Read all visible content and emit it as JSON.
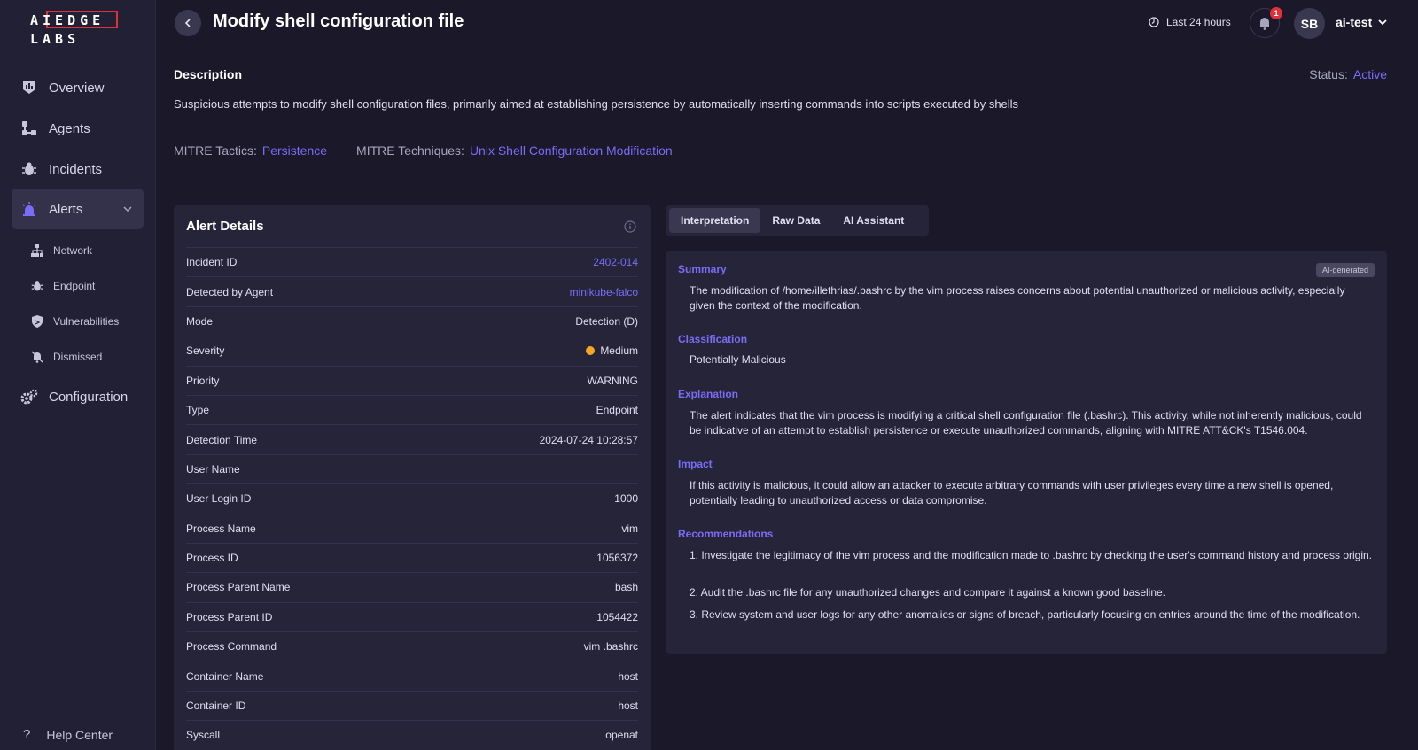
{
  "logo": {
    "line1": "AIEDGE",
    "line2": "LABS"
  },
  "sidebar": {
    "items": [
      {
        "label": "Overview"
      },
      {
        "label": "Agents"
      },
      {
        "label": "Incidents"
      },
      {
        "label": "Alerts"
      },
      {
        "label": "Configuration"
      }
    ],
    "sub_items": [
      {
        "label": "Network"
      },
      {
        "label": "Endpoint"
      },
      {
        "label": "Vulnerabilities"
      },
      {
        "label": "Dismissed"
      }
    ],
    "help": {
      "icon": "?",
      "label": "Help Center"
    }
  },
  "header": {
    "title": "Modify shell configuration file",
    "time_range": "Last 24 hours",
    "notification_count": "1",
    "avatar_initials": "SB",
    "username": "ai-test"
  },
  "description": {
    "heading": "Description",
    "status_label": "Status:",
    "status_value": "Active",
    "text": "Suspicious attempts to modify shell configuration files, primarily aimed at establishing persistence by automatically inserting commands into scripts executed by shells",
    "tactics_label": "MITRE Tactics:",
    "tactics_value": "Persistence",
    "techniques_label": "MITRE Techniques:",
    "techniques_value": "Unix Shell Configuration Modification"
  },
  "alert_details": {
    "title": "Alert Details",
    "rows": [
      {
        "key": "Incident ID",
        "value": "2402-014"
      },
      {
        "key": "Detected by Agent",
        "value": "minikube-falco"
      },
      {
        "key": "Mode",
        "value": "Detection (D)"
      },
      {
        "key": "Severity",
        "value": "Medium"
      },
      {
        "key": "Priority",
        "value": "WARNING"
      },
      {
        "key": "Type",
        "value": "Endpoint"
      },
      {
        "key": "Detection Time",
        "value": "2024-07-24 10:28:57"
      },
      {
        "key": "User Name",
        "value": ""
      },
      {
        "key": "User Login ID",
        "value": "1000"
      },
      {
        "key": "Process Name",
        "value": "vim"
      },
      {
        "key": "Process ID",
        "value": "1056372"
      },
      {
        "key": "Process Parent Name",
        "value": "bash"
      },
      {
        "key": "Process Parent ID",
        "value": "1054422"
      },
      {
        "key": "Process Command",
        "value": "vim .bashrc"
      },
      {
        "key": "Container Name",
        "value": "host"
      },
      {
        "key": "Container ID",
        "value": "host"
      },
      {
        "key": "Syscall",
        "value": "openat"
      }
    ]
  },
  "tabs": [
    {
      "label": "Interpretation"
    },
    {
      "label": "Raw Data"
    },
    {
      "label": "AI Assistant"
    }
  ],
  "interpretation": {
    "badge": "AI-generated",
    "summary_h": "Summary",
    "summary_t": "The modification of /home/illethrias/.bashrc by the vim process raises concerns about potential unauthorized or malicious activity, especially given the context of the modification.",
    "classification_h": "Classification",
    "classification_t": "Potentially Malicious",
    "explanation_h": "Explanation",
    "explanation_t": "The alert indicates that the vim process is modifying a critical shell configuration file (.bashrc). This activity, while not inherently malicious, could be indicative of an attempt to establish persistence or execute unauthorized commands, aligning with MITRE ATT&CK's T1546.004.",
    "impact_h": "Impact",
    "impact_t": "If this activity is malicious, it could allow an attacker to execute arbitrary commands with user privileges every time a new shell is opened, potentially leading to unauthorized access or data compromise.",
    "recommendations_h": "Recommendations",
    "rec1": "1. Investigate the legitimacy of the vim process and the modification made to .bashrc by checking the user's command history and process origin.",
    "rec2": "2. Audit the .bashrc file for any unauthorized changes and compare it against a known good baseline.",
    "rec3": "3. Review system and user logs for any other anomalies or signs of breach, particularly focusing on entries around the time of the modification."
  },
  "colors": {
    "accent": "#7b6cf6",
    "severity_medium": "#f5a623",
    "logo_red": "#e0313b"
  }
}
